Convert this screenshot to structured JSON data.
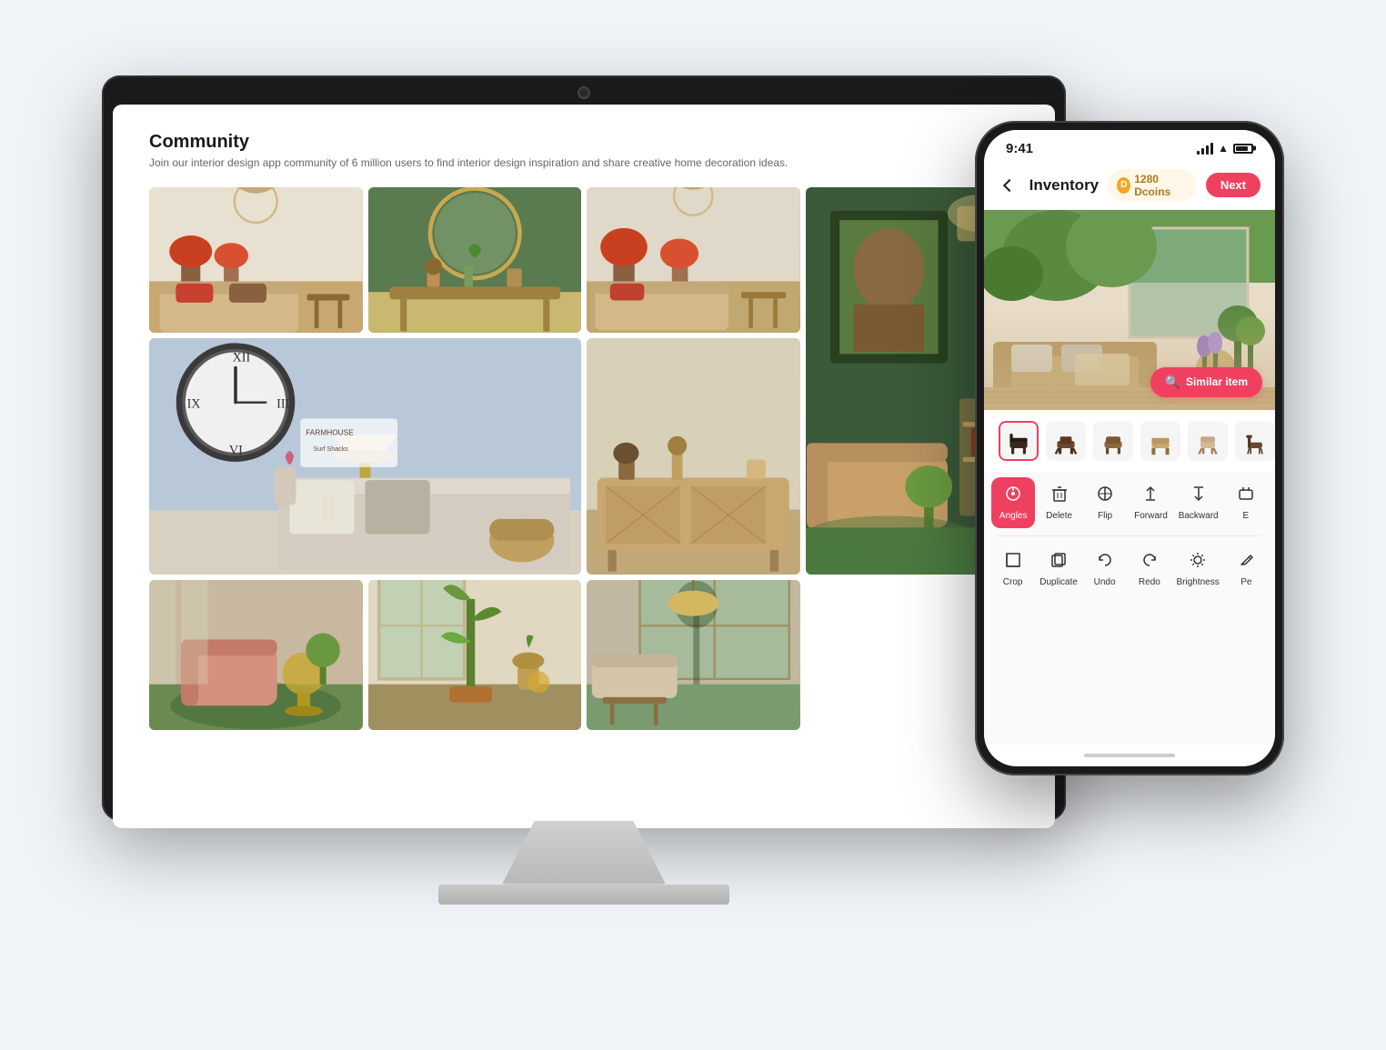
{
  "page": {
    "bg_color": "#f0f4f8"
  },
  "monitor": {
    "screen": {
      "title": "Community",
      "subtitle": "Join our interior design app community of 6 million users to find interior design inspiration and share creative home decoration ideas.",
      "grid_images": [
        {
          "id": 1,
          "alt": "Autumn living room with flowers",
          "class": "cell-autumn-living"
        },
        {
          "id": 2,
          "alt": "Green console with round mirror",
          "class": "cell-green-console"
        },
        {
          "id": 3,
          "alt": "Autumn room with orange flowers",
          "class": "cell-autumn-room"
        },
        {
          "id": 4,
          "alt": "Dark portrait room with lamp",
          "class": "cell-dark-portrait",
          "tall": true
        },
        {
          "id": 5,
          "alt": "Farmhouse bedroom styling",
          "class": "cell-farmhouse",
          "wide": true
        },
        {
          "id": 6,
          "alt": "Cane sideboard",
          "class": "cell-cane-sideboard"
        },
        {
          "id": 7,
          "alt": "Pink lounge chair",
          "class": "cell-lounge"
        },
        {
          "id": 8,
          "alt": "Plants corner with decor",
          "class": "cell-plants-corner"
        },
        {
          "id": 9,
          "alt": "Dining room",
          "class": "cell-dining"
        }
      ]
    }
  },
  "phone": {
    "status_bar": {
      "time": "9:41",
      "signal": "signal",
      "wifi": "wifi",
      "battery": "battery"
    },
    "nav": {
      "back_label": "back",
      "title": "Inventory",
      "dcoins": "1280 Dcoins",
      "next_label": "Next"
    },
    "similar_btn_label": "Similar item",
    "thumbnails": [
      {
        "id": 1,
        "label": "chair variant 1"
      },
      {
        "id": 2,
        "label": "chair variant 2"
      },
      {
        "id": 3,
        "label": "chair variant 3"
      },
      {
        "id": 4,
        "label": "chair variant 4"
      },
      {
        "id": 5,
        "label": "chair variant 5"
      },
      {
        "id": 6,
        "label": "chair variant 6"
      }
    ],
    "tools_row1": [
      {
        "id": "angles",
        "label": "Angles",
        "icon": "🐾",
        "active": true
      },
      {
        "id": "delete",
        "label": "Delete",
        "icon": "🗑"
      },
      {
        "id": "flip",
        "label": "Flip",
        "icon": "⊗"
      },
      {
        "id": "forward",
        "label": "Forward",
        "icon": "↑"
      },
      {
        "id": "backward",
        "label": "Backward",
        "icon": "↓"
      },
      {
        "id": "extra1",
        "label": "E",
        "icon": "⋯"
      }
    ],
    "tools_row2": [
      {
        "id": "crop",
        "label": "Crop",
        "icon": "⬜"
      },
      {
        "id": "duplicate",
        "label": "Duplicate",
        "icon": "⧉"
      },
      {
        "id": "undo",
        "label": "Undo",
        "icon": "↩"
      },
      {
        "id": "redo",
        "label": "Redo",
        "icon": "↪"
      },
      {
        "id": "brightness",
        "label": "Brightness",
        "icon": "☀"
      },
      {
        "id": "extra2",
        "label": "Pe",
        "icon": "✏"
      }
    ]
  }
}
